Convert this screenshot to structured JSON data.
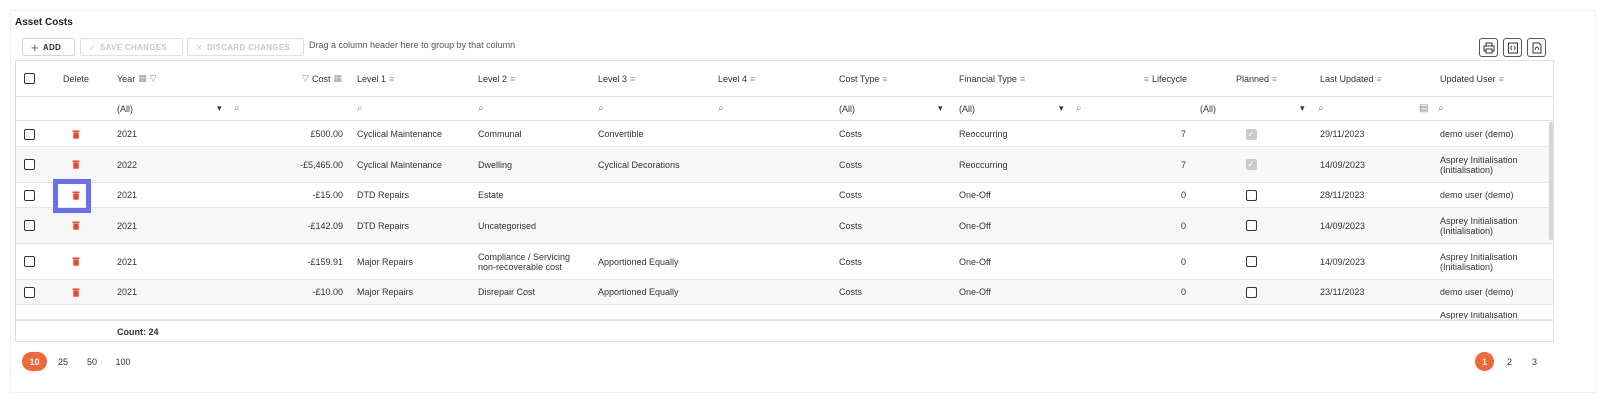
{
  "title": "Asset Costs",
  "toolbar": {
    "add_label": "ADD",
    "save_label": "SAVE CHANGES",
    "discard_label": "DISCARD CHANGES",
    "group_hint": "Drag a column header here to group by that column"
  },
  "columns": {
    "delete": "Delete",
    "year": "Year",
    "cost": "Cost",
    "level1": "Level 1",
    "level2": "Level 2",
    "level3": "Level 3",
    "level4": "Level 4",
    "cost_type": "Cost Type",
    "financial_type": "Financial Type",
    "lifecycle": "Lifecycle",
    "planned": "Planned",
    "last_updated": "Last Updated",
    "updated_user": "Updated User"
  },
  "filters": {
    "year": "(All)",
    "cost_type": "(All)",
    "financial_type": "(All)",
    "planned": "(All)"
  },
  "rows": [
    {
      "year": "2021",
      "cost": "£500.00",
      "level1": "Cyclical Maintenance",
      "level2": "Communal",
      "level3": "Convertible",
      "level4": "",
      "cost_type": "Costs",
      "financial_type": "Reoccurring",
      "lifecycle": "7",
      "planned": "disabled-checked",
      "last_updated": "29/11/2023",
      "updated_user": "demo user (demo)"
    },
    {
      "year": "2022",
      "cost": "-£5,465.00",
      "level1": "Cyclical Maintenance",
      "level2": "Dwelling",
      "level3": "Cyclical Decorations",
      "level4": "",
      "cost_type": "Costs",
      "financial_type": "Reoccurring",
      "lifecycle": "7",
      "planned": "disabled-checked",
      "last_updated": "14/09/2023",
      "updated_user": "Asprey Initialisation (Initialisation)"
    },
    {
      "year": "2021",
      "cost": "-£15.00",
      "level1": "DTD Repairs",
      "level2": "Estate",
      "level3": "",
      "level4": "",
      "cost_type": "Costs",
      "financial_type": "One-Off",
      "lifecycle": "0",
      "planned": "unchecked",
      "last_updated": "28/11/2023",
      "updated_user": "demo user (demo)"
    },
    {
      "year": "2021",
      "cost": "-£142.09",
      "level1": "DTD Repairs",
      "level2": "Uncategorised",
      "level3": "",
      "level4": "",
      "cost_type": "Costs",
      "financial_type": "One-Off",
      "lifecycle": "0",
      "planned": "unchecked",
      "last_updated": "14/09/2023",
      "updated_user": "Asprey Initialisation (Initialisation)"
    },
    {
      "year": "2021",
      "cost": "-£159.91",
      "level1": "Major Repairs",
      "level2": "Compliance / Servicing non-recoverable cost",
      "level3": "Apportioned Equally",
      "level4": "",
      "cost_type": "Costs",
      "financial_type": "One-Off",
      "lifecycle": "0",
      "planned": "unchecked",
      "last_updated": "14/09/2023",
      "updated_user": "Asprey Initialisation (Initialisation)"
    },
    {
      "year": "2021",
      "cost": "-£10.00",
      "level1": "Major Repairs",
      "level2": "Disrepair Cost",
      "level3": "Apportioned Equally",
      "level4": "",
      "cost_type": "Costs",
      "financial_type": "One-Off",
      "lifecycle": "0",
      "planned": "unchecked",
      "last_updated": "23/11/2023",
      "updated_user": "demo user (demo)"
    }
  ],
  "partial_row_user": "Asprey Initialisation",
  "footer": {
    "count": "Count: 24"
  },
  "page_sizes": [
    "10",
    "25",
    "50",
    "100"
  ],
  "pages": [
    "1",
    "2",
    "3"
  ],
  "colors": {
    "accent": "#f0673a",
    "highlight": "#6a6ef0",
    "trash": "#f0452a"
  }
}
